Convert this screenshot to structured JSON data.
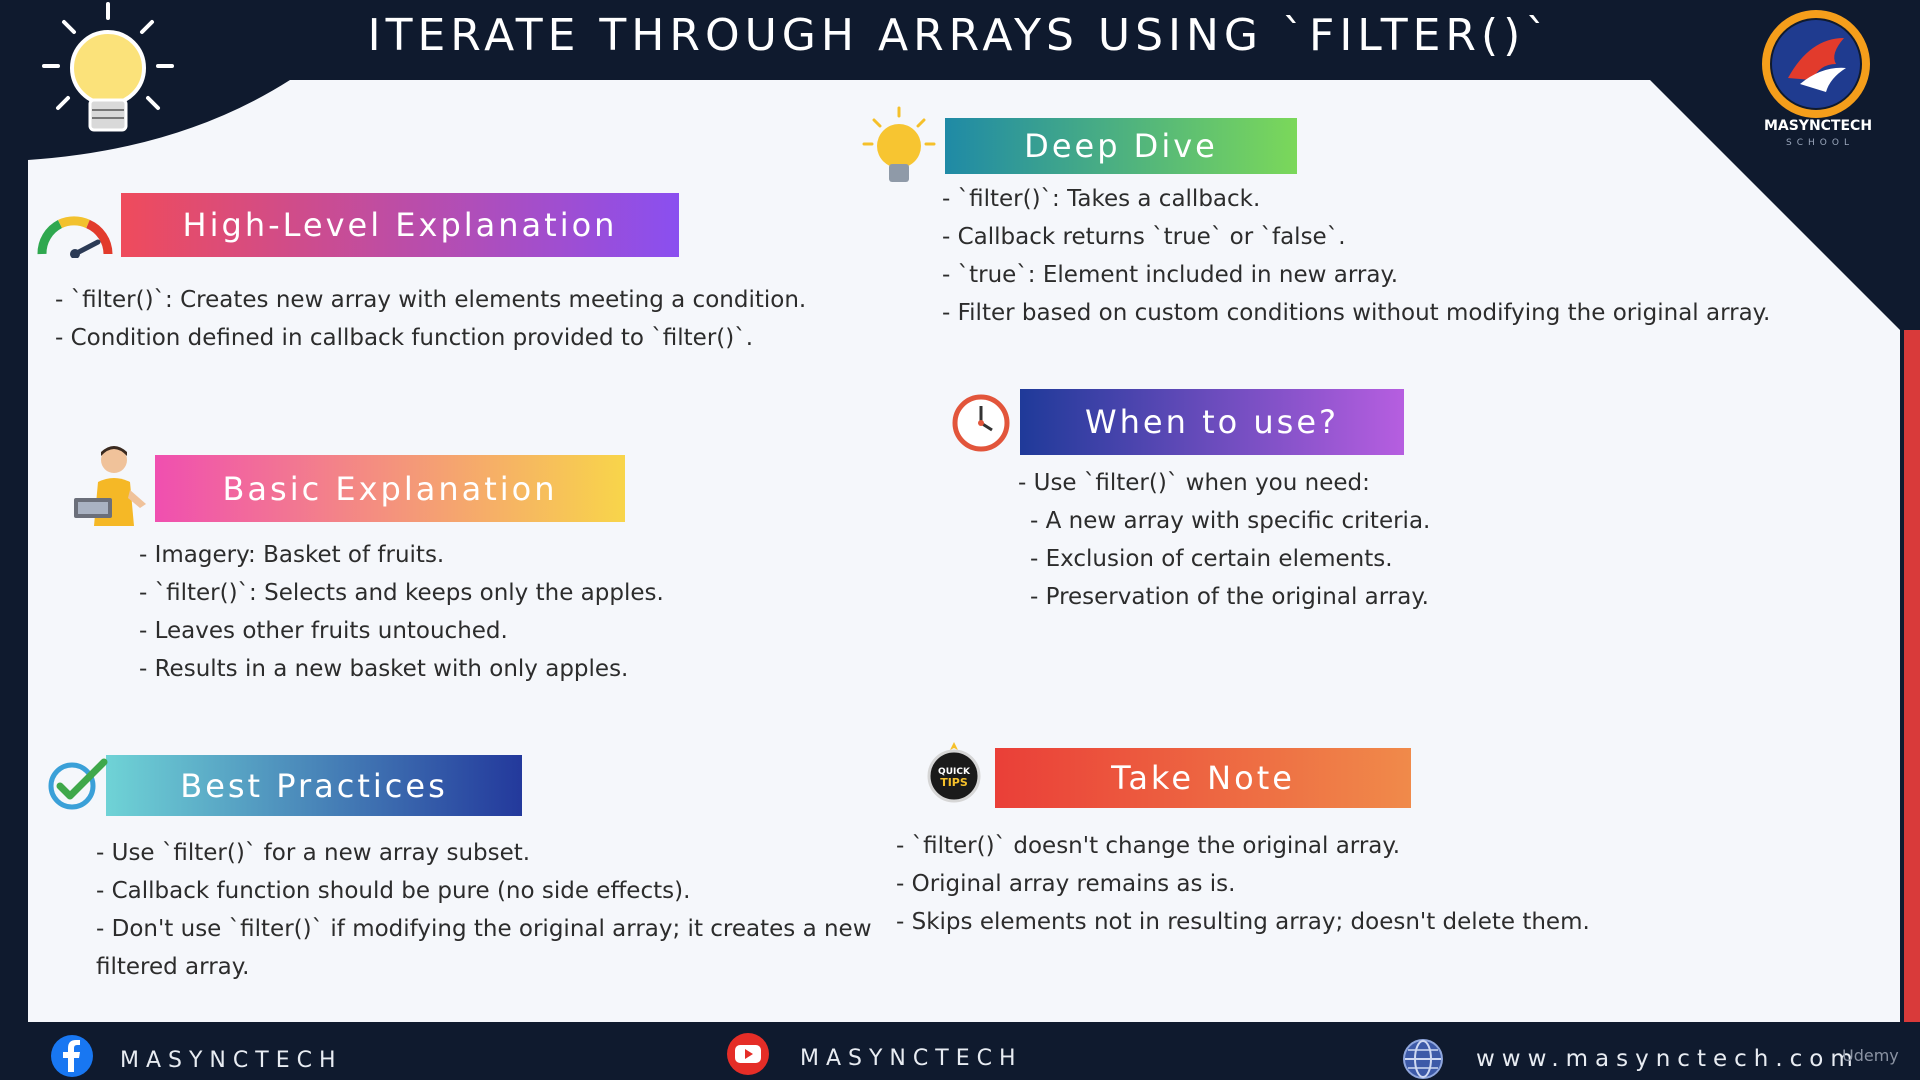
{
  "title": "ITERATE THROUGH ARRAYS USING `FILTER()`",
  "brand": {
    "name": "MASYNCTECH",
    "subtitle": "SCHOOL"
  },
  "sections": {
    "high_level": {
      "heading": "High-Level Explanation",
      "bullets": [
        "- `filter()`: Creates new array with elements meeting a condition.",
        "- Condition defined in callback function provided to `filter()`."
      ]
    },
    "deep_dive": {
      "heading": "Deep Dive",
      "bullets": [
        "- `filter()`: Takes a callback.",
        "- Callback returns `true` or `false`.",
        "- `true`: Element included in new array.",
        "- Filter based on custom conditions without modifying the original array."
      ]
    },
    "basic": {
      "heading": "Basic Explanation",
      "bullets": [
        "- Imagery: Basket of fruits.",
        "- `filter()`: Selects and keeps only the apples.",
        "- Leaves other fruits untouched.",
        "- Results in a new basket with only apples."
      ]
    },
    "when": {
      "heading": "When to use?",
      "bullets": [
        "- Use `filter()` when you need:",
        "  - A new array with specific criteria.",
        "  - Exclusion of certain elements.",
        "  - Preservation of the original array."
      ]
    },
    "best": {
      "heading": "Best Practices",
      "bullets": [
        "- Use `filter()` for a new array subset.",
        "- Callback function should be pure (no side effects).",
        "- Don't use `filter()` if modifying the original array; it creates a new",
        "filtered array."
      ]
    },
    "note": {
      "heading": "Take Note",
      "bullets": [
        "- `filter()` doesn't change the original array.",
        "- Original array remains as is.",
        "- Skips elements not in resulting array; doesn't delete them."
      ]
    }
  },
  "tips_badge": "QUICK TIPS",
  "footer": {
    "facebook": "MASYNCTECH",
    "youtube": "MASYNCTECH",
    "website": "www.masynctech.com"
  },
  "watermark": "Udemy",
  "colors": {
    "navy": "#0f1a2e",
    "panel": "#f5f7fb",
    "accent_red": "#d93a3a"
  },
  "icons": [
    "lightbulb-icon",
    "speedometer-icon",
    "person-laptop-icon",
    "checkmark-icon",
    "clock-icon",
    "quick-tips-icon",
    "facebook-icon",
    "youtube-icon",
    "globe-icon",
    "masynctech-logo"
  ]
}
